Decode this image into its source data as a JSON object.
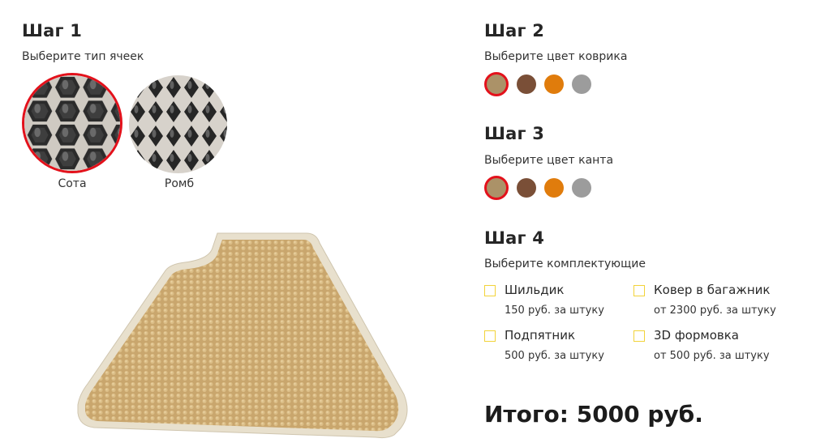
{
  "step1": {
    "title": "Шаг 1",
    "subtitle": "Выберите тип ячеек",
    "options": [
      {
        "label": "Сота",
        "selected": true,
        "pattern": "honeycomb"
      },
      {
        "label": "Ромб",
        "selected": false,
        "pattern": "rhombus"
      }
    ]
  },
  "step2": {
    "title": "Шаг 2",
    "subtitle": "Выберите цвет коврика",
    "colors": [
      "#ab9268",
      "#7a4f37",
      "#e07c0c",
      "#9c9c9c"
    ],
    "selected_index": 0
  },
  "step3": {
    "title": "Шаг 3",
    "subtitle": "Выберите цвет канта",
    "colors": [
      "#ab9268",
      "#7a4f37",
      "#e07c0c",
      "#9c9c9c"
    ],
    "selected_index": 0
  },
  "step4": {
    "title": "Шаг 4",
    "subtitle": "Выберите комплектующие",
    "items": [
      {
        "name": "Шильдик",
        "price": "150 руб. за штуку",
        "checked": false
      },
      {
        "name": "Ковер в багажник",
        "price": "от 2300 руб. за штуку",
        "checked": false
      },
      {
        "name": "Подпятник",
        "price": "500 руб. за штуку",
        "checked": false
      },
      {
        "name": "3D формовка",
        "price": "от 500 руб. за штуку",
        "checked": false
      }
    ]
  },
  "total": "Итого: 5000 руб.",
  "accent_color": "#e3111b",
  "checkbox_color": "#f2d33a",
  "mat_preview": {
    "mat_color": "#d8bd8c",
    "edge_color": "#e6ddc8"
  }
}
